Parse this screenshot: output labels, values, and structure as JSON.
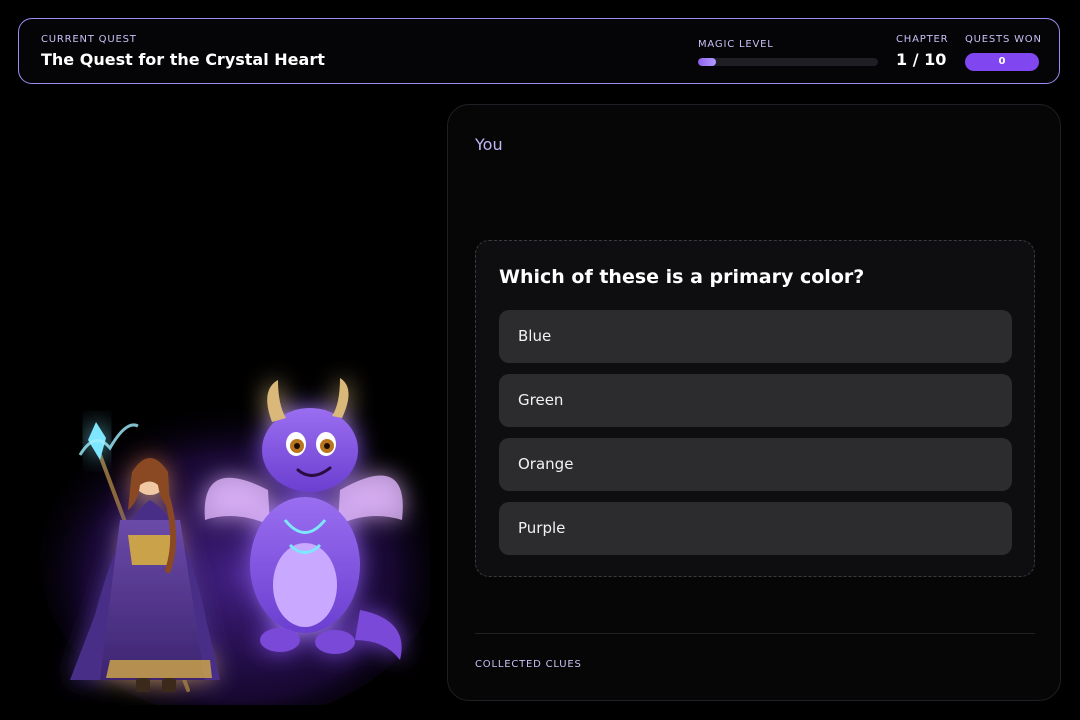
{
  "header": {
    "current_quest_label": "CURRENT QUEST",
    "quest_title": "The Quest for the Crystal Heart",
    "magic_level_label": "MAGIC LEVEL",
    "magic_level_fraction": 0.1,
    "chapter_label": "CHAPTER",
    "chapter_value": "1 / 10",
    "quests_won_label": "QUESTS WON",
    "quests_won_value": "0"
  },
  "panel": {
    "speaker": "You",
    "question": "Which of these is a primary color?",
    "options": [
      "Blue",
      "Green",
      "Orange",
      "Purple"
    ],
    "collected_clues_label": "COLLECTED CLUES"
  },
  "colors": {
    "accent": "#8046f0",
    "accent_light": "#c9bff5",
    "background": "#000000",
    "option_bg": "#2c2c2e"
  }
}
